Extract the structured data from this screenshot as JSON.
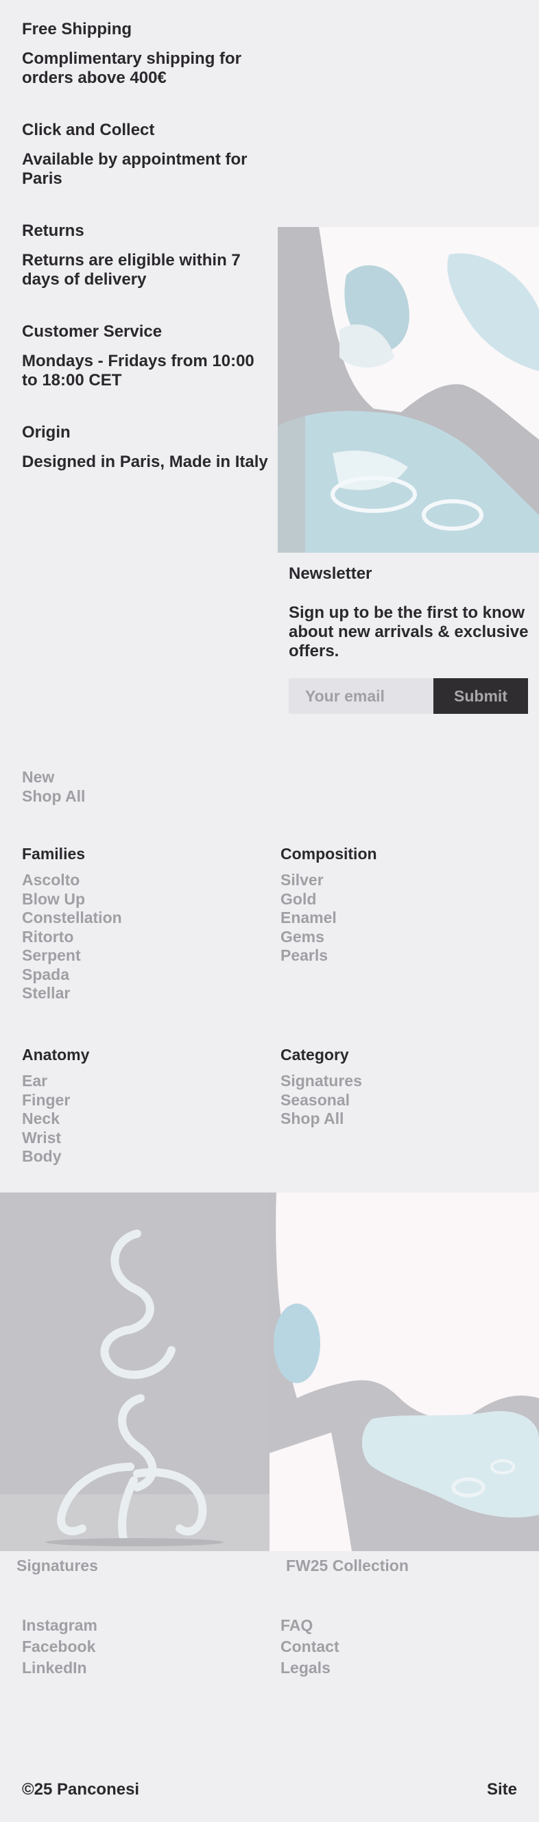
{
  "info": [
    {
      "title": "Free Shipping",
      "text": "Complimentary shipping for orders above 400€"
    },
    {
      "title": "Click and Collect",
      "text": "Available by appointment for Paris"
    },
    {
      "title": "Returns",
      "text": "Returns are eligible within 7 days of delivery"
    },
    {
      "title": "Customer Service",
      "text": "Mondays - Fridays from 10:00 to 18:00 CET"
    },
    {
      "title": "Origin",
      "text": "Designed in Paris, Made in Italy"
    }
  ],
  "newsletter": {
    "title": "Newsletter",
    "text": "Sign up to be the first to know about new arrivals & exclusive offers.",
    "placeholder": "Your email",
    "submit": "Submit"
  },
  "top_links": [
    "New",
    "Shop All"
  ],
  "families": {
    "title": "Families",
    "items": [
      "Ascolto",
      "Blow Up",
      "Constellation",
      "Ritorto",
      "Serpent",
      "Spada",
      "Stellar"
    ]
  },
  "composition": {
    "title": "Composition",
    "items": [
      "Silver",
      "Gold",
      "Enamel",
      "Gems",
      "Pearls"
    ]
  },
  "anatomy": {
    "title": "Anatomy",
    "items": [
      "Ear",
      "Finger",
      "Neck",
      "Wrist",
      "Body"
    ]
  },
  "category": {
    "title": "Category",
    "items": [
      "Signatures",
      "Seasonal",
      "Shop All"
    ]
  },
  "features": [
    {
      "caption": "Signatures"
    },
    {
      "caption": "FW25 Collection"
    }
  ],
  "social": [
    "Instagram",
    "Facebook",
    "LinkedIn"
  ],
  "help": [
    "FAQ",
    "Contact",
    "Legals"
  ],
  "footer": {
    "copyright": "©25 Panconesi",
    "site": "Site"
  }
}
